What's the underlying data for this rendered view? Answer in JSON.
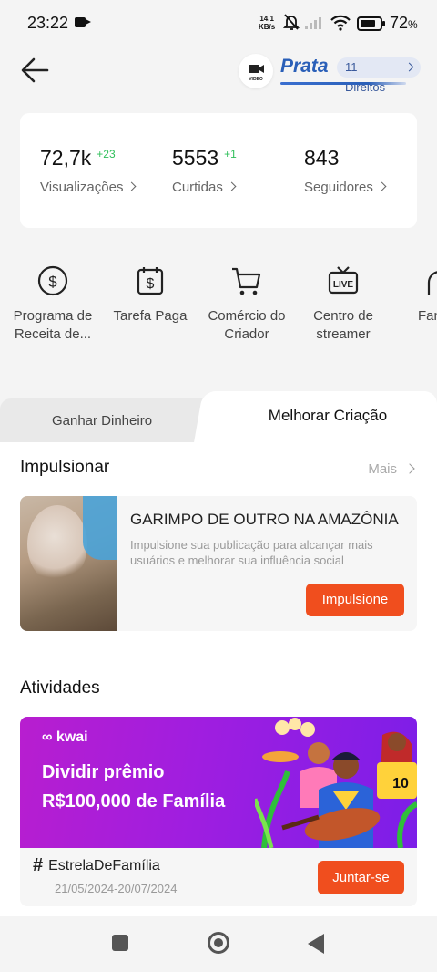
{
  "status_bar": {
    "time": "23:22",
    "net_speed_value": "14,1",
    "net_speed_unit": "KB/s",
    "battery": "72",
    "battery_unit": "%"
  },
  "header": {
    "level_icon_text": "VIDEO",
    "level_name": "Prata",
    "rights_label": "11 Direitos"
  },
  "stats": [
    {
      "value": "72,7k",
      "delta": "+23",
      "label": "Visualizações"
    },
    {
      "value": "5553",
      "delta": "+1",
      "label": "Curtidas"
    },
    {
      "value": "843",
      "delta": "",
      "label": "Seguidores"
    }
  ],
  "tools": [
    {
      "icon": "dollar-circle-icon",
      "label_line1": "Programa de",
      "label_line2": "Receita de..."
    },
    {
      "icon": "paid-task-icon",
      "label_line1": "Tarefa Paga",
      "label_line2": ""
    },
    {
      "icon": "cart-icon",
      "label_line1": "Comércio do",
      "label_line2": "Criador"
    },
    {
      "icon": "live-tv-icon",
      "label_line1": "Centro de",
      "label_line2": "streamer"
    },
    {
      "icon": "fan-icon",
      "label_line1": "Fan",
      "label_line2": ""
    }
  ],
  "tabs": {
    "left": "Ganhar Dinheiro",
    "right": "Melhorar Criação"
  },
  "boost": {
    "section_title": "Impulsionar",
    "more_label": "Mais",
    "title": "GARIMPO DE OUTRO NA AMAZÔNIA",
    "description": "Impulsione sua publicação para alcançar mais usuários e melhorar sua influência social",
    "button_label": "Impulsione"
  },
  "activities": {
    "section_title": "Atividades",
    "brand": "kwai",
    "promo_line1": "Dividir prêmio",
    "promo_line2": "R$100,000 de Família",
    "jersey_number": "10",
    "hashtag_symbol": "#",
    "hashtag": "EstrelaDeFamília",
    "dates": "21/05/2024-20/07/2024",
    "button_label": "Juntar-se"
  },
  "colors": {
    "accent_orange": "#f04e1e",
    "level_blue": "#2a5fb8",
    "delta_green": "#2fbf5a",
    "banner_purple": "#9f1ee0"
  }
}
